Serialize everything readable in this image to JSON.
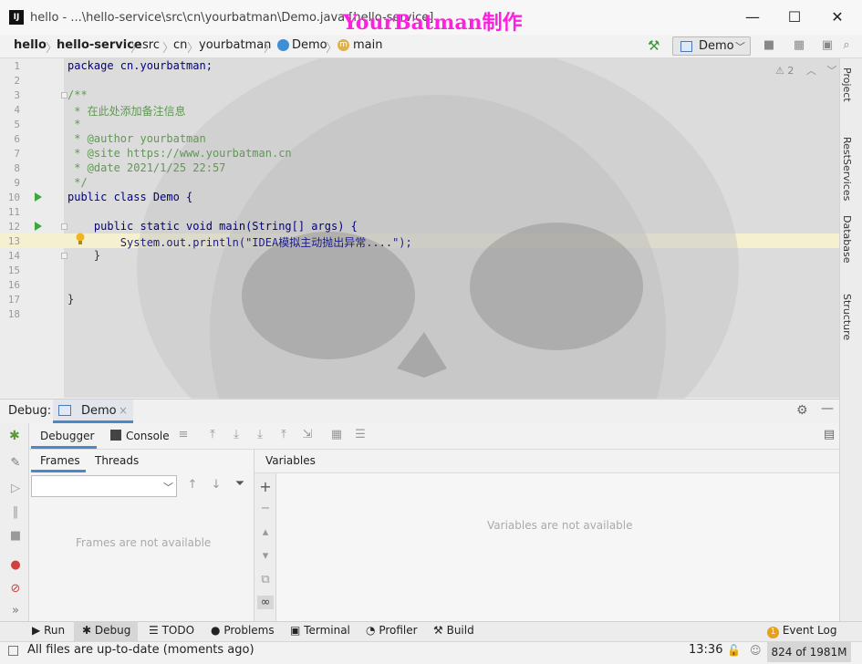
{
  "window": {
    "title": "hello - ...\\hello-service\\src\\cn\\yourbatman\\Demo.java [hello-service]",
    "watermark": "YourBatman制作",
    "minimize": "—",
    "maximize": "☐",
    "close": "✕"
  },
  "breadcrumbs": [
    "hello",
    "hello-service",
    "src",
    "cn",
    "yourbatman",
    "Demo",
    "main"
  ],
  "run_config": {
    "label": "Demo"
  },
  "editor": {
    "problems_count": "2",
    "current_line": 13,
    "lines": [
      {
        "n": "1",
        "code": "package cn.yourbatman;"
      },
      {
        "n": "2",
        "code": ""
      },
      {
        "n": "3",
        "code": "/**"
      },
      {
        "n": "4",
        "code": " * 在此处添加备注信息"
      },
      {
        "n": "5",
        "code": " *"
      },
      {
        "n": "6",
        "code": " * @author yourbatman"
      },
      {
        "n": "7",
        "code": " * @site https://www.yourbatman.cn"
      },
      {
        "n": "8",
        "code": " * @date 2021/1/25 22:57"
      },
      {
        "n": "9",
        "code": " */"
      },
      {
        "n": "10",
        "code": "public class Demo {"
      },
      {
        "n": "11",
        "code": ""
      },
      {
        "n": "12",
        "code": "    public static void main(String[] args) {"
      },
      {
        "n": "13",
        "code": "        System.out.println(\"IDEA模拟主动抛出异常....\");"
      },
      {
        "n": "14",
        "code": "    }"
      },
      {
        "n": "15",
        "code": ""
      },
      {
        "n": "16",
        "code": ""
      },
      {
        "n": "17",
        "code": "}"
      },
      {
        "n": "18",
        "code": ""
      }
    ]
  },
  "right_tabs": [
    "Project",
    "RestServices",
    "Database",
    "Structure"
  ],
  "debug": {
    "title": "Debug:",
    "session_tab": "Demo",
    "tabs": [
      "Debugger",
      "Console"
    ],
    "frames_tab": "Frames",
    "threads_tab": "Threads",
    "variables_tab": "Variables",
    "frames_empty": "Frames are not available",
    "variables_empty": "Variables are not available"
  },
  "bottom_tools": [
    "Run",
    "Debug",
    "TODO",
    "Problems",
    "Terminal",
    "Profiler",
    "Build"
  ],
  "event_log": {
    "label": "Event Log",
    "badge": "1"
  },
  "status": {
    "message": "All files are up-to-date (moments ago)",
    "time": "13:36",
    "memory": "824 of 1981M"
  },
  "colors": {
    "keyword": "#000080",
    "comment": "#629755",
    "string": "#008000",
    "method": "#0070c0",
    "class_name": "#1c1cb0",
    "accent": "#3ea63e",
    "watermark": "#ff1fe0"
  }
}
